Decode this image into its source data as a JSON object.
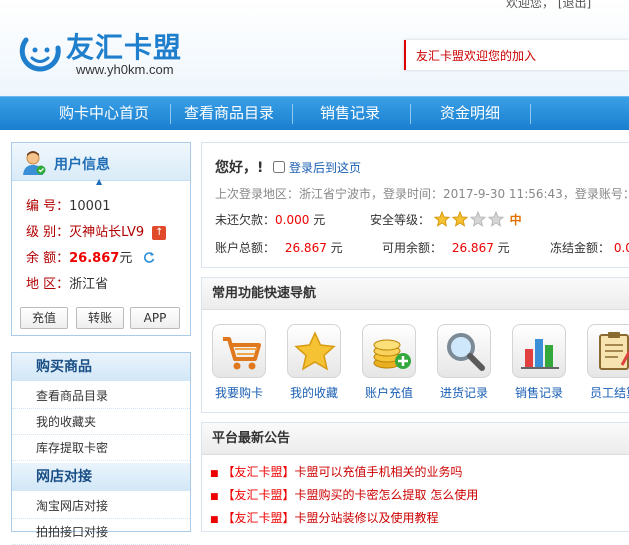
{
  "top": {
    "links": "欢迎您，  [退出]"
  },
  "logo": {
    "name": "友汇卡盟",
    "url": "www.yh0km.com"
  },
  "welcome": {
    "text": "友汇卡盟欢迎您的加入"
  },
  "nav": [
    "购卡中心首页",
    "查看商品目录",
    "销售记录",
    "资金明细"
  ],
  "user_panel": {
    "title": "用户信息",
    "rows": [
      {
        "key": "编  号：",
        "value": "10001"
      },
      {
        "key": "级  别：",
        "value": "灭神站长LV9"
      },
      {
        "key": "余  额：",
        "value": "26.867",
        "unit": "元"
      },
      {
        "key": "地  区：",
        "value": "浙江省"
      }
    ],
    "buttons": [
      "充值",
      "转账",
      "APP"
    ]
  },
  "menu": {
    "sections": [
      {
        "title": "购买商品",
        "items": [
          "查看商品目录",
          "我的收藏夹",
          "库存提取卡密"
        ]
      },
      {
        "title": "网店对接",
        "items": [
          "淘宝网店对接",
          "拍拍接口对接"
        ]
      }
    ]
  },
  "account": {
    "greeting": "您好，!",
    "remember": "登录后到这页",
    "last_login": "上次登录地区：浙江省宁波市，登录时间：2017-9-30 11:56:43，登录账号：",
    "debt_label": "未还欠款：",
    "debt_value": "0.000",
    "unit": "元",
    "security_label": "安全等级：",
    "security_stars": 2,
    "security_max": 4,
    "security_level": "中",
    "total_label": "账户总额：",
    "total_value": "26.867",
    "available_label": "可用余额：",
    "available_value": "26.867",
    "frozen_label": "冻结金额：",
    "frozen_value": "0.0"
  },
  "quicknav": {
    "title": "常用功能快速导航",
    "items": [
      {
        "label": "我要购卡",
        "icon": "cart-icon"
      },
      {
        "label": "我的收藏",
        "icon": "star-icon"
      },
      {
        "label": "账户充值",
        "icon": "coins-icon"
      },
      {
        "label": "进货记录",
        "icon": "magnifier-icon"
      },
      {
        "label": "销售记录",
        "icon": "bar-chart-icon"
      },
      {
        "label": "员工结算",
        "icon": "clipboard-icon"
      }
    ]
  },
  "notices": {
    "title": "平台最新公告",
    "items": [
      {
        "tag": "【友汇卡盟】",
        "text": "卡盟可以充值手机相关的业务吗"
      },
      {
        "tag": "【友汇卡盟】",
        "text": "卡盟购买的卡密怎么提取 怎么使用"
      },
      {
        "tag": "【友汇卡盟】",
        "text": "卡盟分站装修以及使用教程"
      }
    ]
  },
  "colors": {
    "accent": "#1f7fcc",
    "nav": "#2a8ed8",
    "alert": "#e00000"
  }
}
